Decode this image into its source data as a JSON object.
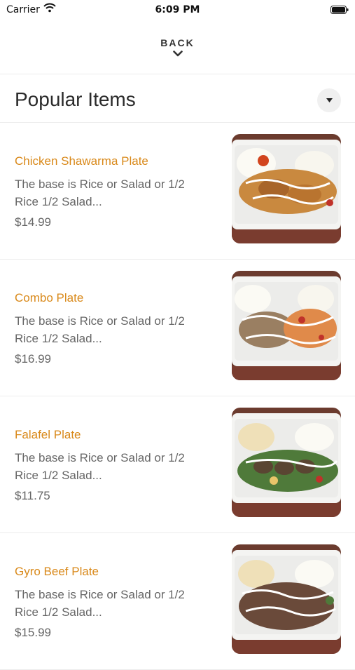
{
  "status_bar": {
    "carrier": "Carrier",
    "time": "6:09 PM"
  },
  "nav": {
    "back_label": "BACK"
  },
  "section": {
    "title": "Popular Items"
  },
  "items": [
    {
      "name": "Chicken Shawarma Plate",
      "description": "The base is Rice or Salad or 1/2 Rice 1/2 Salad...",
      "price": "$14.99",
      "image": "chicken-shawarma-plate-photo"
    },
    {
      "name": "Combo Plate",
      "description": "The base is Rice or Salad or 1/2 Rice 1/2 Salad...",
      "price": "$16.99",
      "image": "combo-plate-photo"
    },
    {
      "name": "Falafel Plate",
      "description": "The base is Rice or Salad or 1/2 Rice 1/2 Salad...",
      "price": "$11.75",
      "image": "falafel-plate-photo"
    },
    {
      "name": "Gyro Beef Plate",
      "description": "The base is Rice or Salad or 1/2 Rice 1/2 Salad...",
      "price": "$15.99",
      "image": "gyro-beef-plate-photo"
    }
  ],
  "colors": {
    "item_name": "#d9891a",
    "text_secondary": "#666666",
    "divider": "#ececec"
  }
}
